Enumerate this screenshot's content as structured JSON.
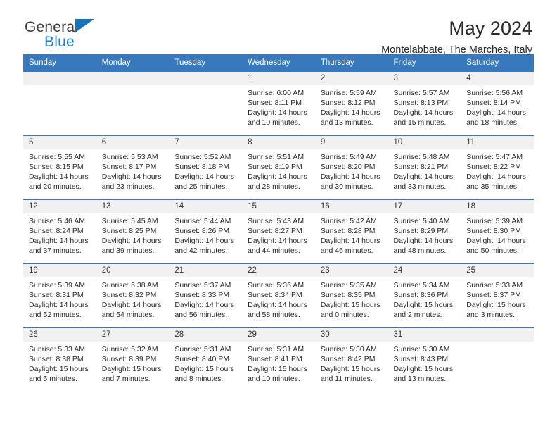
{
  "brand": {
    "name_top": "General",
    "name_bottom": "Blue",
    "triangle_icon": "blue-triangle-icon",
    "accent_color": "#1473bb"
  },
  "header": {
    "title": "May 2024",
    "subtitle": "Montelabbate, The Marches, Italy"
  },
  "calendar": {
    "header_bg": "#3878bc",
    "daynum_bg": "#f1f1f1",
    "weekdays": [
      "Sunday",
      "Monday",
      "Tuesday",
      "Wednesday",
      "Thursday",
      "Friday",
      "Saturday"
    ],
    "labels": {
      "sunrise": "Sunrise:",
      "sunset": "Sunset:",
      "daylight": "Daylight:"
    },
    "weeks": [
      [
        {
          "day": ""
        },
        {
          "day": ""
        },
        {
          "day": ""
        },
        {
          "day": "1",
          "sunrise": "Sunrise: 6:00 AM",
          "sunset": "Sunset: 8:11 PM",
          "daylight_1": "Daylight: 14 hours",
          "daylight_2": "and 10 minutes."
        },
        {
          "day": "2",
          "sunrise": "Sunrise: 5:59 AM",
          "sunset": "Sunset: 8:12 PM",
          "daylight_1": "Daylight: 14 hours",
          "daylight_2": "and 13 minutes."
        },
        {
          "day": "3",
          "sunrise": "Sunrise: 5:57 AM",
          "sunset": "Sunset: 8:13 PM",
          "daylight_1": "Daylight: 14 hours",
          "daylight_2": "and 15 minutes."
        },
        {
          "day": "4",
          "sunrise": "Sunrise: 5:56 AM",
          "sunset": "Sunset: 8:14 PM",
          "daylight_1": "Daylight: 14 hours",
          "daylight_2": "and 18 minutes."
        }
      ],
      [
        {
          "day": "5",
          "sunrise": "Sunrise: 5:55 AM",
          "sunset": "Sunset: 8:15 PM",
          "daylight_1": "Daylight: 14 hours",
          "daylight_2": "and 20 minutes."
        },
        {
          "day": "6",
          "sunrise": "Sunrise: 5:53 AM",
          "sunset": "Sunset: 8:17 PM",
          "daylight_1": "Daylight: 14 hours",
          "daylight_2": "and 23 minutes."
        },
        {
          "day": "7",
          "sunrise": "Sunrise: 5:52 AM",
          "sunset": "Sunset: 8:18 PM",
          "daylight_1": "Daylight: 14 hours",
          "daylight_2": "and 25 minutes."
        },
        {
          "day": "8",
          "sunrise": "Sunrise: 5:51 AM",
          "sunset": "Sunset: 8:19 PM",
          "daylight_1": "Daylight: 14 hours",
          "daylight_2": "and 28 minutes."
        },
        {
          "day": "9",
          "sunrise": "Sunrise: 5:49 AM",
          "sunset": "Sunset: 8:20 PM",
          "daylight_1": "Daylight: 14 hours",
          "daylight_2": "and 30 minutes."
        },
        {
          "day": "10",
          "sunrise": "Sunrise: 5:48 AM",
          "sunset": "Sunset: 8:21 PM",
          "daylight_1": "Daylight: 14 hours",
          "daylight_2": "and 33 minutes."
        },
        {
          "day": "11",
          "sunrise": "Sunrise: 5:47 AM",
          "sunset": "Sunset: 8:22 PM",
          "daylight_1": "Daylight: 14 hours",
          "daylight_2": "and 35 minutes."
        }
      ],
      [
        {
          "day": "12",
          "sunrise": "Sunrise: 5:46 AM",
          "sunset": "Sunset: 8:24 PM",
          "daylight_1": "Daylight: 14 hours",
          "daylight_2": "and 37 minutes."
        },
        {
          "day": "13",
          "sunrise": "Sunrise: 5:45 AM",
          "sunset": "Sunset: 8:25 PM",
          "daylight_1": "Daylight: 14 hours",
          "daylight_2": "and 39 minutes."
        },
        {
          "day": "14",
          "sunrise": "Sunrise: 5:44 AM",
          "sunset": "Sunset: 8:26 PM",
          "daylight_1": "Daylight: 14 hours",
          "daylight_2": "and 42 minutes."
        },
        {
          "day": "15",
          "sunrise": "Sunrise: 5:43 AM",
          "sunset": "Sunset: 8:27 PM",
          "daylight_1": "Daylight: 14 hours",
          "daylight_2": "and 44 minutes."
        },
        {
          "day": "16",
          "sunrise": "Sunrise: 5:42 AM",
          "sunset": "Sunset: 8:28 PM",
          "daylight_1": "Daylight: 14 hours",
          "daylight_2": "and 46 minutes."
        },
        {
          "day": "17",
          "sunrise": "Sunrise: 5:40 AM",
          "sunset": "Sunset: 8:29 PM",
          "daylight_1": "Daylight: 14 hours",
          "daylight_2": "and 48 minutes."
        },
        {
          "day": "18",
          "sunrise": "Sunrise: 5:39 AM",
          "sunset": "Sunset: 8:30 PM",
          "daylight_1": "Daylight: 14 hours",
          "daylight_2": "and 50 minutes."
        }
      ],
      [
        {
          "day": "19",
          "sunrise": "Sunrise: 5:39 AM",
          "sunset": "Sunset: 8:31 PM",
          "daylight_1": "Daylight: 14 hours",
          "daylight_2": "and 52 minutes."
        },
        {
          "day": "20",
          "sunrise": "Sunrise: 5:38 AM",
          "sunset": "Sunset: 8:32 PM",
          "daylight_1": "Daylight: 14 hours",
          "daylight_2": "and 54 minutes."
        },
        {
          "day": "21",
          "sunrise": "Sunrise: 5:37 AM",
          "sunset": "Sunset: 8:33 PM",
          "daylight_1": "Daylight: 14 hours",
          "daylight_2": "and 56 minutes."
        },
        {
          "day": "22",
          "sunrise": "Sunrise: 5:36 AM",
          "sunset": "Sunset: 8:34 PM",
          "daylight_1": "Daylight: 14 hours",
          "daylight_2": "and 58 minutes."
        },
        {
          "day": "23",
          "sunrise": "Sunrise: 5:35 AM",
          "sunset": "Sunset: 8:35 PM",
          "daylight_1": "Daylight: 15 hours",
          "daylight_2": "and 0 minutes."
        },
        {
          "day": "24",
          "sunrise": "Sunrise: 5:34 AM",
          "sunset": "Sunset: 8:36 PM",
          "daylight_1": "Daylight: 15 hours",
          "daylight_2": "and 2 minutes."
        },
        {
          "day": "25",
          "sunrise": "Sunrise: 5:33 AM",
          "sunset": "Sunset: 8:37 PM",
          "daylight_1": "Daylight: 15 hours",
          "daylight_2": "and 3 minutes."
        }
      ],
      [
        {
          "day": "26",
          "sunrise": "Sunrise: 5:33 AM",
          "sunset": "Sunset: 8:38 PM",
          "daylight_1": "Daylight: 15 hours",
          "daylight_2": "and 5 minutes."
        },
        {
          "day": "27",
          "sunrise": "Sunrise: 5:32 AM",
          "sunset": "Sunset: 8:39 PM",
          "daylight_1": "Daylight: 15 hours",
          "daylight_2": "and 7 minutes."
        },
        {
          "day": "28",
          "sunrise": "Sunrise: 5:31 AM",
          "sunset": "Sunset: 8:40 PM",
          "daylight_1": "Daylight: 15 hours",
          "daylight_2": "and 8 minutes."
        },
        {
          "day": "29",
          "sunrise": "Sunrise: 5:31 AM",
          "sunset": "Sunset: 8:41 PM",
          "daylight_1": "Daylight: 15 hours",
          "daylight_2": "and 10 minutes."
        },
        {
          "day": "30",
          "sunrise": "Sunrise: 5:30 AM",
          "sunset": "Sunset: 8:42 PM",
          "daylight_1": "Daylight: 15 hours",
          "daylight_2": "and 11 minutes."
        },
        {
          "day": "31",
          "sunrise": "Sunrise: 5:30 AM",
          "sunset": "Sunset: 8:43 PM",
          "daylight_1": "Daylight: 15 hours",
          "daylight_2": "and 13 minutes."
        },
        {
          "day": ""
        }
      ]
    ]
  }
}
